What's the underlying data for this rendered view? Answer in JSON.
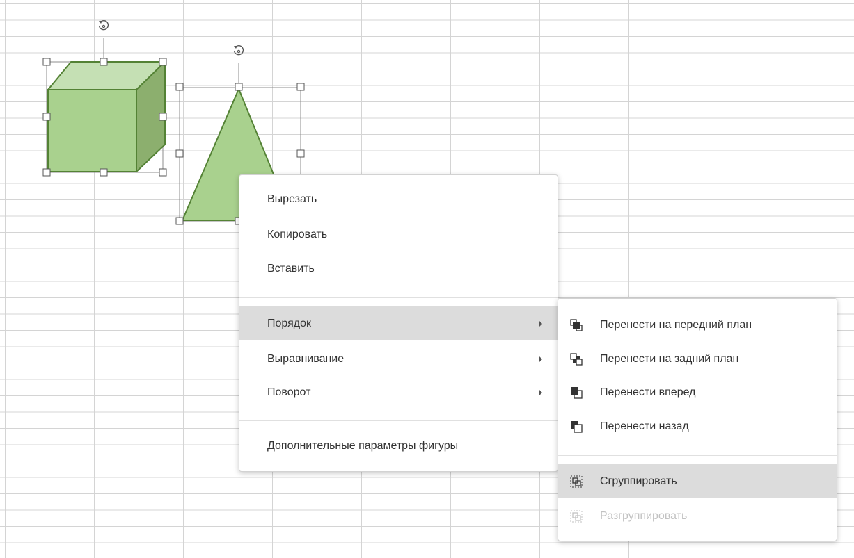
{
  "context_menu": {
    "items": [
      {
        "label": "Вырезать"
      },
      {
        "label": "Копировать"
      },
      {
        "label": "Вставить"
      },
      {
        "label": "Порядок"
      },
      {
        "label": "Выравнивание"
      },
      {
        "label": "Поворот"
      },
      {
        "label": "Дополнительные параметры фигуры"
      }
    ]
  },
  "order_submenu": {
    "items": [
      {
        "label": "Перенести на передний план",
        "icon": "bring-to-front-icon"
      },
      {
        "label": "Перенести на задний план",
        "icon": "send-to-back-icon"
      },
      {
        "label": "Перенести вперед",
        "icon": "bring-forward-icon"
      },
      {
        "label": "Перенести назад",
        "icon": "send-backward-icon"
      },
      {
        "label": "Сгруппировать",
        "icon": "group-icon"
      },
      {
        "label": "Разгруппировать",
        "icon": "ungroup-icon",
        "disabled": true
      }
    ]
  },
  "colors": {
    "shape_fill": "#a9d18e",
    "shape_stroke": "#548235",
    "highlight": "#dcdcdc"
  }
}
